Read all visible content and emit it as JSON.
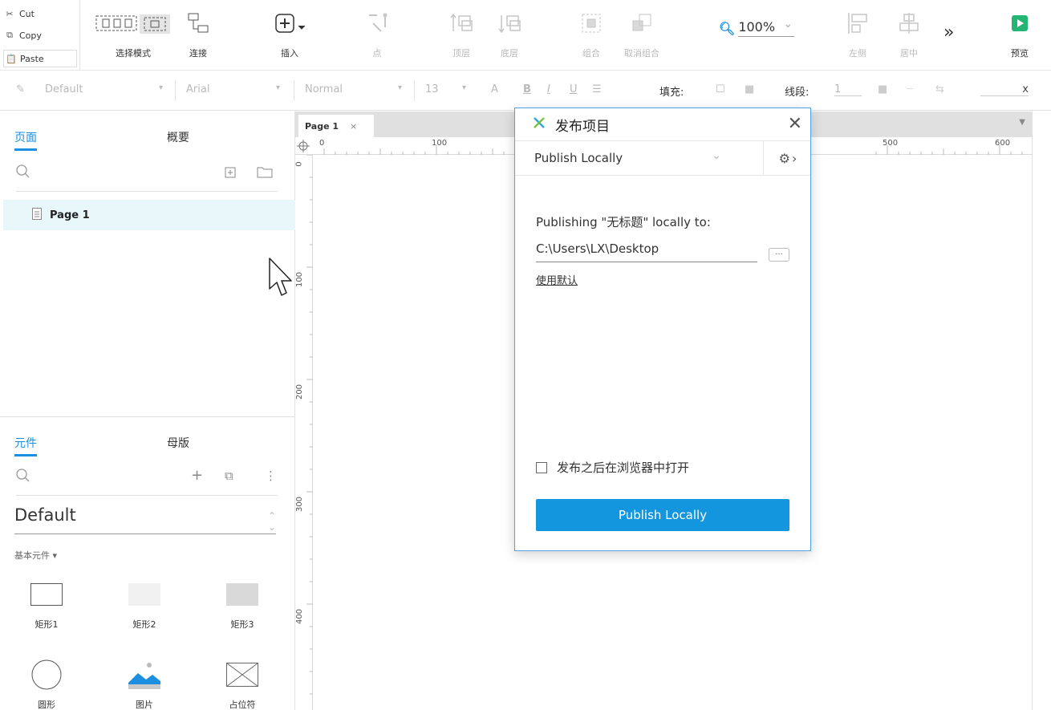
{
  "toolbar": {
    "cut": "Cut",
    "copy": "Copy",
    "paste": "Paste",
    "select_mode": "选择模式",
    "connect": "连接",
    "insert": "插入",
    "point": "点",
    "top_layer": "顶层",
    "bottom_layer": "底层",
    "group": "组合",
    "ungroup": "取消组合",
    "zoom": "100%",
    "align_left": "左侧",
    "align_center": "居中",
    "more": "»",
    "preview": "预览"
  },
  "stylebar": {
    "style": "Default",
    "font": "Arial",
    "weight": "Normal",
    "size": "13",
    "fill_label": "填充:",
    "line_label": "线段:",
    "line_value": "1",
    "x_label": "x"
  },
  "pages_panel": {
    "tab_pages": "页面",
    "tab_outline": "概要",
    "pages": [
      {
        "name": "Page 1"
      }
    ]
  },
  "widgets_panel": {
    "tab_widgets": "元件",
    "tab_masters": "母版",
    "library": "Default",
    "category": "基本元件 ▾",
    "items": [
      {
        "label": "矩形1",
        "icon": "rectangle-icon"
      },
      {
        "label": "矩形2",
        "icon": "rectangle-icon"
      },
      {
        "label": "矩形3",
        "icon": "rectangle-icon"
      },
      {
        "label": "圆形",
        "icon": "circle-icon"
      },
      {
        "label": "图片",
        "icon": "image-icon"
      },
      {
        "label": "占位符",
        "icon": "placeholder-icon"
      }
    ]
  },
  "canvas": {
    "tab": "Page 1",
    "tab_close": "×",
    "hruler": [
      "0",
      "100",
      "500",
      "600"
    ],
    "vruler": [
      "0",
      "100",
      "200",
      "300",
      "400"
    ]
  },
  "dialog": {
    "title": "发布项目",
    "mode": "Publish Locally",
    "message": "Publishing \"无标题\" locally to:",
    "path": "C:\\Users\\LX\\Desktop",
    "browse": "···",
    "use_default": "使用默认",
    "open_after": "发布之后在浏览器中打开",
    "button": "Publish Locally",
    "accent": "#1496de"
  }
}
